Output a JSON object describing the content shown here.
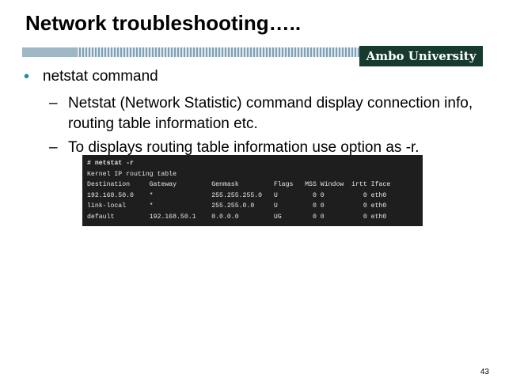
{
  "slide": {
    "title": "Network troubleshooting…..",
    "brand": "Ambo University",
    "bullet": {
      "symbol": "•",
      "text": "netstat command"
    },
    "sub_items": [
      {
        "dash": "–",
        "text": "Netstat (Network Statistic) command display connection info, routing table information etc."
      },
      {
        "dash": "–",
        "text": "To displays routing table information use option as -r."
      }
    ],
    "page_number": "43"
  },
  "terminal": {
    "lines": [
      "# netstat -r",
      "Kernel IP routing table",
      "Destination     Gateway         Genmask         Flags   MSS Window  irtt Iface",
      "192.168.50.0    *               255.255.255.0   U         0 0          0 eth0",
      "link-local      *               255.255.0.0     U         0 0          0 eth0",
      "default         192.168.50.1    0.0.0.0         UG        0 0          0 eth0"
    ]
  },
  "colors": {
    "bullet": "#1f88a2",
    "brand_bg": "#163b2e",
    "terminal_bg": "#1e1e1e"
  }
}
